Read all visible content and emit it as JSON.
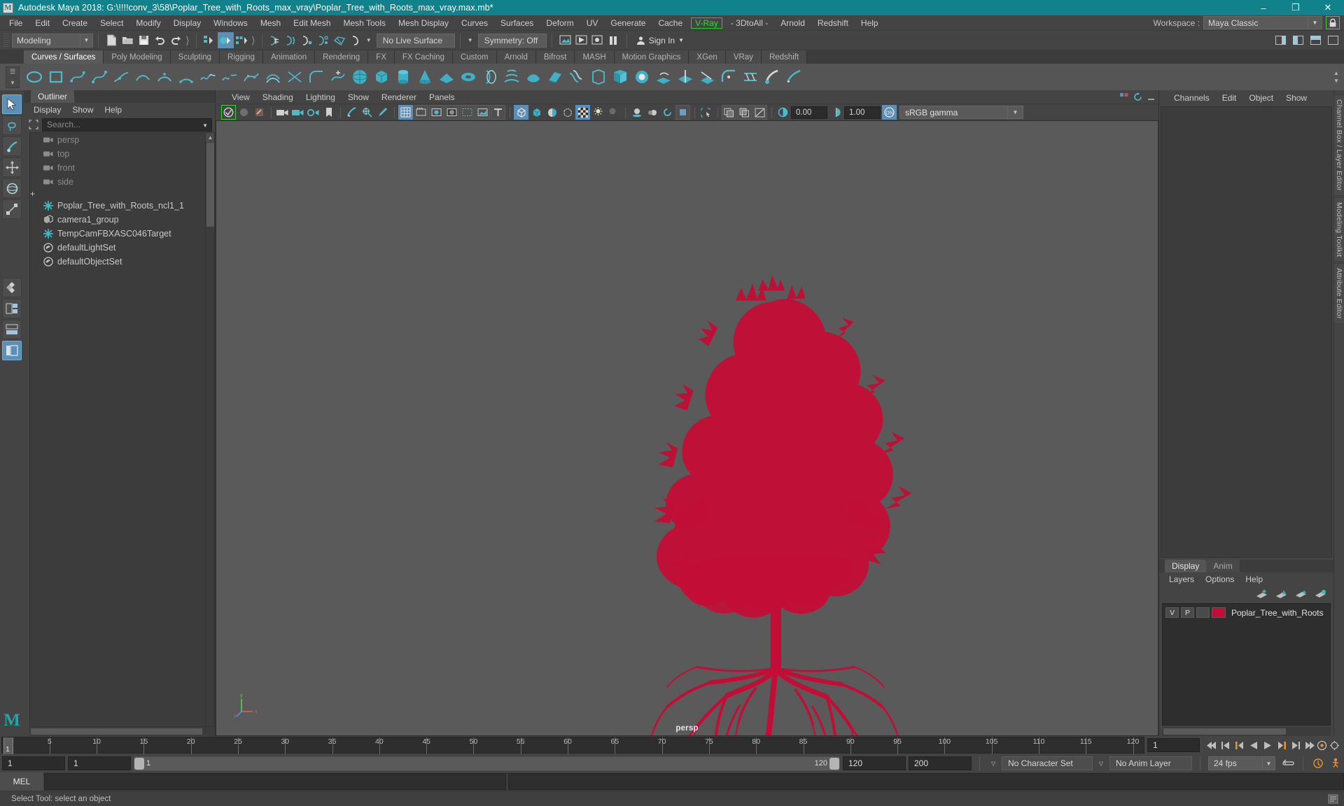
{
  "window": {
    "title": "Autodesk Maya 2018: G:\\!!!!conv_3\\58\\Poplar_Tree_with_Roots_max_vray\\Poplar_Tree_with_Roots_max_vray.max.mb*",
    "app_initial": "M",
    "minimize": "–",
    "maximize": "❐",
    "close": "✕",
    "titlebar_color": "#11828c"
  },
  "menubar": {
    "items": [
      "File",
      "Edit",
      "Create",
      "Select",
      "Modify",
      "Display",
      "Windows",
      "Mesh",
      "Edit Mesh",
      "Mesh Tools",
      "Mesh Display",
      "Curves",
      "Surfaces",
      "Deform",
      "UV",
      "Generate",
      "Cache"
    ],
    "vray_item": "V-Ray",
    "vray_color": "#2fe02f",
    "after_vray": [
      "- 3DtoAll -",
      "Arnold",
      "Redshift",
      "Help"
    ],
    "workspace_label": "Workspace :",
    "workspace_value": "Maya Classic",
    "lock_icon": "lock-icon",
    "lock_border_color": "#3ad23a"
  },
  "statusline": {
    "menu_mode": "Modeling",
    "live_surface": "No Live Surface",
    "symmetry": "Symmetry: Off",
    "sign_in": "Sign In"
  },
  "shelf": {
    "tabs": [
      "Curves / Surfaces",
      "Poly Modeling",
      "Sculpting",
      "Rigging",
      "Animation",
      "Rendering",
      "FX",
      "FX Caching",
      "Custom",
      "Arnold",
      "Bifrost",
      "MASH",
      "Motion Graphics",
      "XGen",
      "VRay",
      "Redshift"
    ],
    "active_tab": "Curves / Surfaces"
  },
  "outliner": {
    "tab": "Outliner",
    "menus": [
      "Display",
      "Show",
      "Help"
    ],
    "search_placeholder": "Search...",
    "items": [
      {
        "label": "persp",
        "icon": "camera-icon",
        "dim": true,
        "expandable": false
      },
      {
        "label": "top",
        "icon": "camera-icon",
        "dim": true,
        "expandable": false
      },
      {
        "label": "front",
        "icon": "camera-icon",
        "dim": true,
        "expandable": false
      },
      {
        "label": "side",
        "icon": "camera-icon",
        "dim": true,
        "expandable": false
      },
      {
        "label": "Poplar_Tree_with_Roots_ncl1_1",
        "icon": "transform-icon",
        "dim": false,
        "expandable": true
      },
      {
        "label": "camera1_group",
        "icon": "group-icon",
        "dim": false,
        "expandable": false
      },
      {
        "label": "TempCamFBXASC046Target",
        "icon": "transform-icon",
        "dim": false,
        "expandable": false
      },
      {
        "label": "defaultLightSet",
        "icon": "set-icon",
        "dim": false,
        "expandable": false
      },
      {
        "label": "defaultObjectSet",
        "icon": "set-icon",
        "dim": false,
        "expandable": false
      }
    ]
  },
  "viewport": {
    "menus": [
      "View",
      "Shading",
      "Lighting",
      "Show",
      "Renderer",
      "Panels"
    ],
    "exposure": "0.00",
    "gamma_value": "1.00",
    "color_profile": "sRGB gamma",
    "camera_label": "persp",
    "background_color": "#5a5a5a",
    "model_color": "#c20e36",
    "axis_labels": {
      "x": "x",
      "y": "y",
      "z": "z"
    }
  },
  "channelbox": {
    "menus": [
      "Channels",
      "Edit",
      "Object",
      "Show"
    ]
  },
  "layers": {
    "tabs": [
      "Display",
      "Anim"
    ],
    "active_tab": "Display",
    "menus": [
      "Layers",
      "Options",
      "Help"
    ],
    "rows": [
      {
        "visibility": "V",
        "playback": "P",
        "type": "",
        "color": "#c20e36",
        "name": "Poplar_Tree_with_Roots"
      }
    ]
  },
  "side_tabs": [
    "Channel Box / Layer Editor",
    "Modeling Toolkit",
    "Attribute Editor"
  ],
  "timeline": {
    "ticks": [
      5,
      10,
      15,
      20,
      25,
      30,
      35,
      40,
      45,
      50,
      55,
      60,
      65,
      70,
      75,
      80,
      85,
      90,
      95,
      100,
      105,
      110,
      115,
      120
    ],
    "start": 1,
    "end": 120,
    "current_frame": "1",
    "current_frame_field": "1",
    "playback_buttons": [
      "go-to-start-icon",
      "step-back-frame-icon",
      "step-back-key-icon",
      "play-backwards-icon",
      "play-forwards-icon",
      "step-forward-key-icon",
      "step-forward-frame-icon",
      "go-to-end-icon"
    ]
  },
  "range_slider": {
    "anim_start": "1",
    "range_start": "1",
    "slider_start_label": "1",
    "slider_end_label": "120",
    "range_end": "120",
    "anim_end": "200",
    "character_set": "No Character Set",
    "anim_layer": "No Anim Layer",
    "fps": "24 fps"
  },
  "command_line": {
    "language_tab": "MEL",
    "input_value": ""
  },
  "statusbar": {
    "message": "Select Tool: select an object"
  }
}
